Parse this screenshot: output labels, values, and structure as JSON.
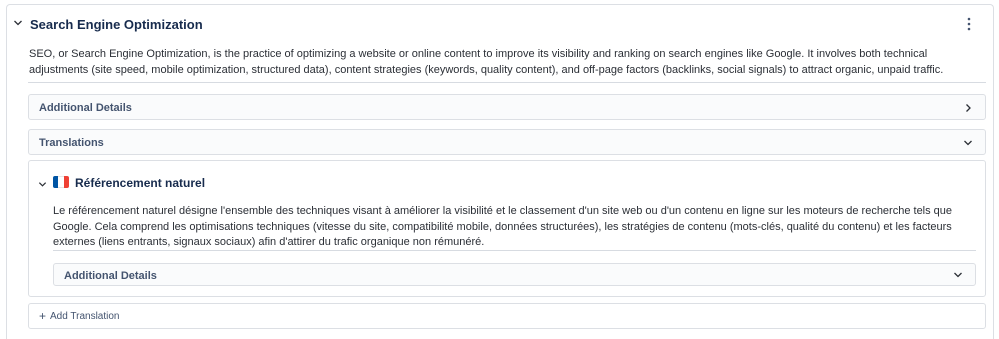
{
  "section": {
    "title": "Search Engine Optimization",
    "description": "SEO, or Search Engine Optimization, is the practice of optimizing a website or online content to improve its visibility and ranking on search engines like Google. It involves both technical adjustments (site speed, mobile optimization, structured data), content strategies (keywords, quality content), and off-page factors (backlinks, social signals) to attract organic, unpaid traffic.",
    "menu_icon": "more-vertical-icon",
    "expand_icon": "chevron-down-icon"
  },
  "additional_details": {
    "label": "Additional Details",
    "icon": "chevron-right-icon"
  },
  "translations": {
    "label": "Translations",
    "icon": "chevron-down-icon",
    "items": [
      {
        "flag": "france-flag-icon",
        "flag_colors": [
          "#0055A4",
          "#FFFFFF",
          "#EF4135"
        ],
        "title": "Référencement naturel",
        "description": "Le référencement naturel désigne l'ensemble des techniques visant à améliorer la visibilité et le classement d'un site web ou d'un contenu en ligne sur les moteurs de recherche tels que Google. Cela comprend les optimisations techniques (vitesse du site, compatibilité mobile, données structurées), les stratégies de contenu (mots-clés, qualité du contenu) et les facteurs externes (liens entrants, signaux sociaux) afin d'attirer du trafic organique non rémunéré.",
        "additional_details_label": "Additional Details"
      }
    ],
    "add_label": "Add Translation",
    "add_icon": "plus-icon"
  }
}
